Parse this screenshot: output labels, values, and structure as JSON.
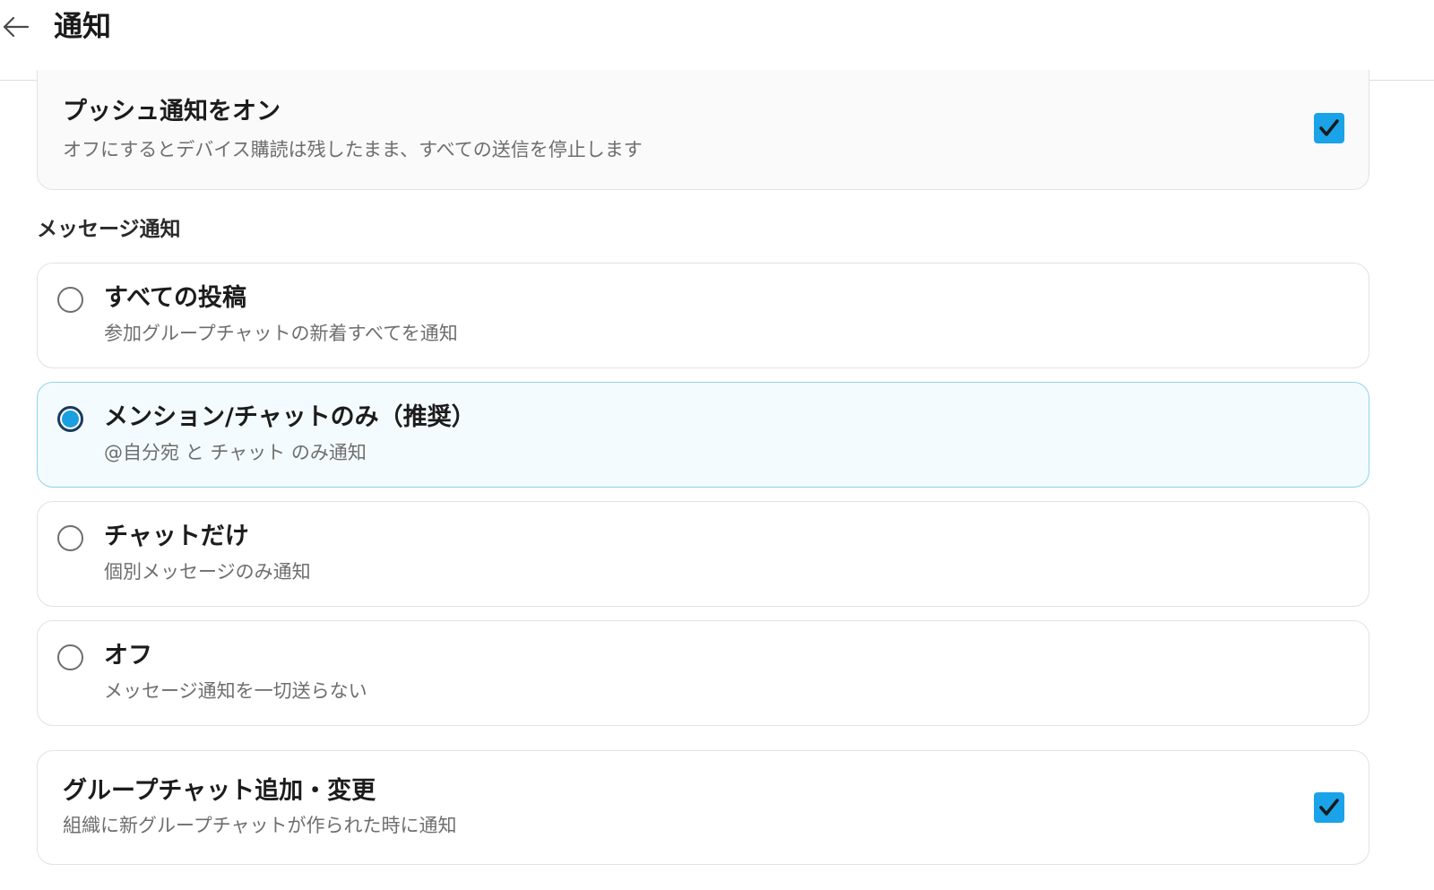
{
  "header": {
    "back_icon": "arrow-left-icon",
    "title": "通知"
  },
  "push": {
    "title": "プッシュ通知をオン",
    "description": "オフにするとデバイス購読は残したまま、すべての送信を停止します",
    "checked": true
  },
  "message_section": {
    "label": "メッセージ通知",
    "options": [
      {
        "title": "すべての投稿",
        "description": "参加グループチャットの新着すべてを通知",
        "selected": false
      },
      {
        "title": "メンション/チャットのみ（推奨）",
        "description": "@自分宛 と チャット のみ通知",
        "selected": true
      },
      {
        "title": "チャットだけ",
        "description": "個別メッセージのみ通知",
        "selected": false
      },
      {
        "title": "オフ",
        "description": "メッセージ通知を一切送らない",
        "selected": false
      }
    ]
  },
  "group_chat": {
    "title": "グループチャット追加・変更",
    "description": "組織に新グループチャットが作られた時に通知",
    "checked": true
  },
  "colors": {
    "accent": "#1aa3e8",
    "selected_border": "#8fd3ea",
    "selected_bg": "#f4fbfe"
  }
}
